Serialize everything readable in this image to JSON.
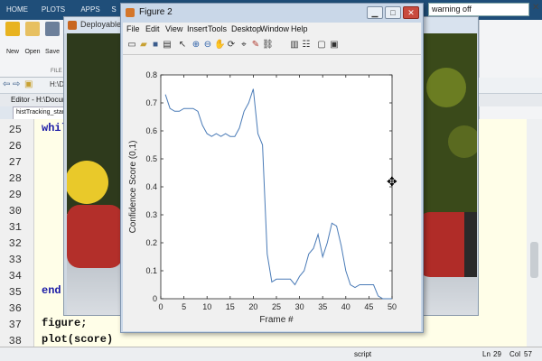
{
  "ribbon": {
    "tabs": [
      "HOME",
      "PLOTS",
      "APPS",
      "S"
    ],
    "buttons": [
      {
        "label": "New",
        "icon": "new-plus-icon"
      },
      {
        "label": "Open",
        "icon": "open-folder-icon"
      },
      {
        "label": "Save",
        "icon": "save-disk-icon"
      }
    ],
    "section_label": "FILE"
  },
  "command_box": {
    "value": "warning off"
  },
  "address_bar": {
    "path": "H:\\Docum"
  },
  "editor": {
    "title": "Editor - H:\\Docum",
    "tab": "histTracking_start",
    "line_numbers": [
      "25",
      "26",
      "27",
      "28",
      "29",
      "30",
      "31",
      "32",
      "33",
      "34",
      "35",
      "36",
      "37",
      "38"
    ],
    "lines": [
      {
        "n": "25",
        "text": "whil"
      },
      {
        "n": "35",
        "text": "end"
      },
      {
        "n": "37",
        "text": "figure;"
      },
      {
        "n": "38",
        "text": "plot(score)"
      }
    ]
  },
  "video_window": {
    "title": "Deployable Vi"
  },
  "figure": {
    "title": "Figure 2",
    "menu": [
      "File",
      "Edit",
      "View",
      "Insert",
      "Tools",
      "Desktop",
      "Window",
      "Help"
    ],
    "toolbar_icons": [
      "new-figure-icon",
      "open-file-icon",
      "save-icon",
      "print-icon",
      "select-arrow-icon",
      "zoom-in-icon",
      "zoom-out-icon",
      "pan-hand-icon",
      "rotate-icon",
      "data-cursor-icon",
      "brush-icon",
      "link-icon",
      "colorbar-icon",
      "legend-icon",
      "hide-plot-tools-icon",
      "show-plot-tools-icon"
    ]
  },
  "chart_data": {
    "type": "line",
    "xlabel": "Frame #",
    "ylabel": "Confidence Score (0,1)",
    "xlim": [
      0,
      50
    ],
    "ylim": [
      0,
      0.8
    ],
    "xticks": [
      0,
      5,
      10,
      15,
      20,
      25,
      30,
      35,
      40,
      45,
      50
    ],
    "yticks": [
      0,
      0.1,
      0.2,
      0.3,
      0.4,
      0.5,
      0.6,
      0.7,
      0.8
    ],
    "line_color": "#4a7bb7",
    "series": [
      {
        "x": [
          1,
          2,
          3,
          4,
          5,
          6,
          7,
          8,
          9,
          10,
          11,
          12,
          13,
          14,
          15,
          16,
          17,
          18,
          19,
          20,
          21,
          22,
          23,
          24,
          25,
          26,
          27,
          28,
          29,
          30,
          31,
          32,
          33,
          34,
          35,
          36,
          37,
          38,
          39,
          40,
          41,
          42,
          43,
          44,
          45,
          46,
          47,
          48,
          49,
          50
        ],
        "values": [
          0.73,
          0.68,
          0.67,
          0.67,
          0.68,
          0.68,
          0.68,
          0.67,
          0.62,
          0.59,
          0.58,
          0.59,
          0.58,
          0.59,
          0.58,
          0.58,
          0.61,
          0.67,
          0.7,
          0.75,
          0.59,
          0.55,
          0.16,
          0.06,
          0.07,
          0.07,
          0.07,
          0.07,
          0.05,
          0.08,
          0.1,
          0.16,
          0.18,
          0.23,
          0.15,
          0.2,
          0.27,
          0.26,
          0.19,
          0.1,
          0.05,
          0.04,
          0.05,
          0.05,
          0.05,
          0.05,
          0.01,
          0.0,
          0.0,
          0.0
        ]
      }
    ]
  },
  "statusbar": {
    "mode": "script",
    "ln_label": "Ln",
    "ln": "29",
    "col_label": "Col",
    "col": "57"
  },
  "colors": {
    "ribbon": "#1f4e79",
    "editor_bg": "#fffee8",
    "keyword": "#1a1aa6"
  }
}
